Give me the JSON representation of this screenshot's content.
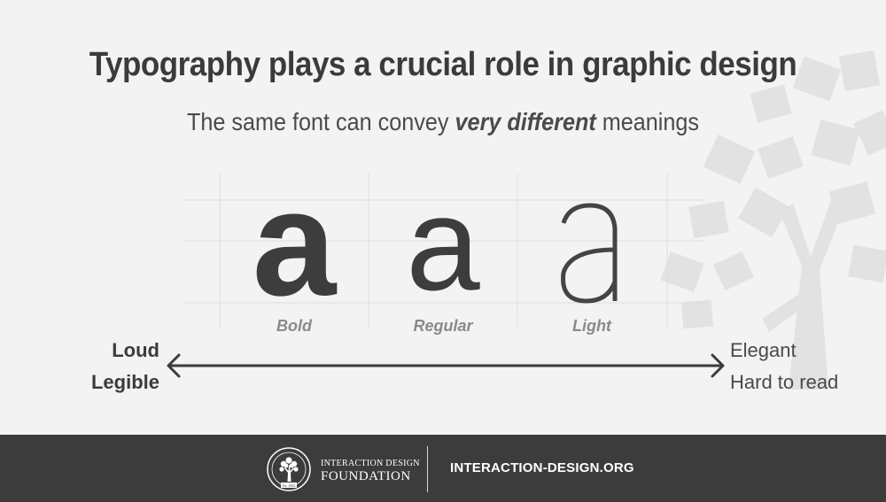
{
  "title": "Typography plays a crucial role in graphic design",
  "subtitle": {
    "before": "The same font can convey ",
    "emphasis": "very different",
    "after": " meanings"
  },
  "glyphs": [
    {
      "char": "a",
      "weight": "Bold"
    },
    {
      "char": "a",
      "weight": "Regular"
    },
    {
      "char": "a",
      "weight": "Light"
    }
  ],
  "scale": {
    "left": [
      "Loud",
      "Legible"
    ],
    "right": [
      "Elegant",
      "Hard to read"
    ]
  },
  "footer": {
    "org_line1": "INTERACTION DESIGN",
    "org_line2": "FOUNDATION",
    "website": "INTERACTION-DESIGN.ORG",
    "logo_text": "Est. 2002"
  },
  "colors": {
    "background": "#f3f3f3",
    "text_dark": "#3b3b3b",
    "label_gray": "#8a8a8a",
    "footer_bg": "#3c3c3c",
    "decoration": "#e2e2e2"
  }
}
